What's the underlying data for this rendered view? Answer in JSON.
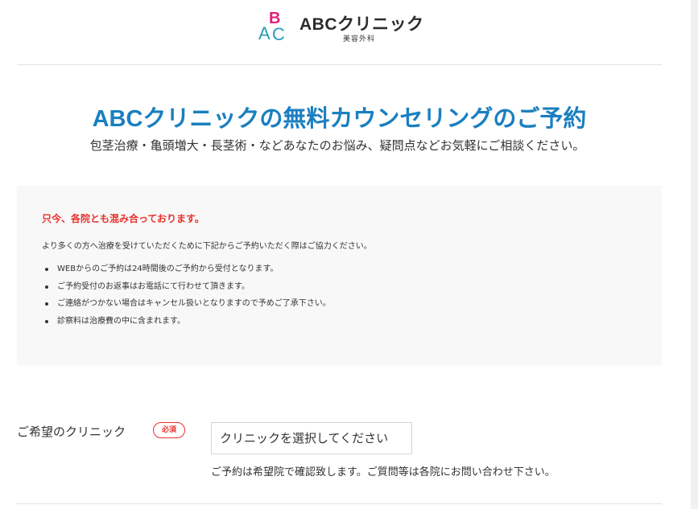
{
  "header": {
    "brand_name": "ABCクリニック",
    "brand_sub": "美容外科",
    "logo_letters": {
      "b": "B",
      "a": "A",
      "c": "C"
    }
  },
  "hero": {
    "title": "ABCクリニックの無料カウンセリングのご予約",
    "subtitle": "包茎治療・亀頭増大・長茎術・などあなたのお悩み、疑問点などお気軽にご相談ください。"
  },
  "notice": {
    "headline": "只今、各院とも混み合っております。",
    "lead": "より多くの方へ治療を受けていただくために下記からご予約いただく際はご協力ください。",
    "items": [
      "WEBからのご予約は24時間後のご予約から受付となります。",
      "ご予約受付のお返事はお電話にて行わせて頂きます。",
      "ご連絡がつかない場合はキャンセル扱いとなりますので予めご了承下さい。",
      "診察料は治療費の中に含まれます。"
    ]
  },
  "form": {
    "clinic_label": "ご希望のクリニック",
    "required_badge": "必須",
    "clinic_select_value": "クリニックを選択してください",
    "clinic_note": "ご予約は希望院で確認致します。ご質問等は各院にお問い合わせ下さい。"
  },
  "colors": {
    "title_blue": "#1a7fc0",
    "alert_red": "#e8322d",
    "logo_pink": "#e0217a",
    "logo_teal": "#2a9db3"
  }
}
